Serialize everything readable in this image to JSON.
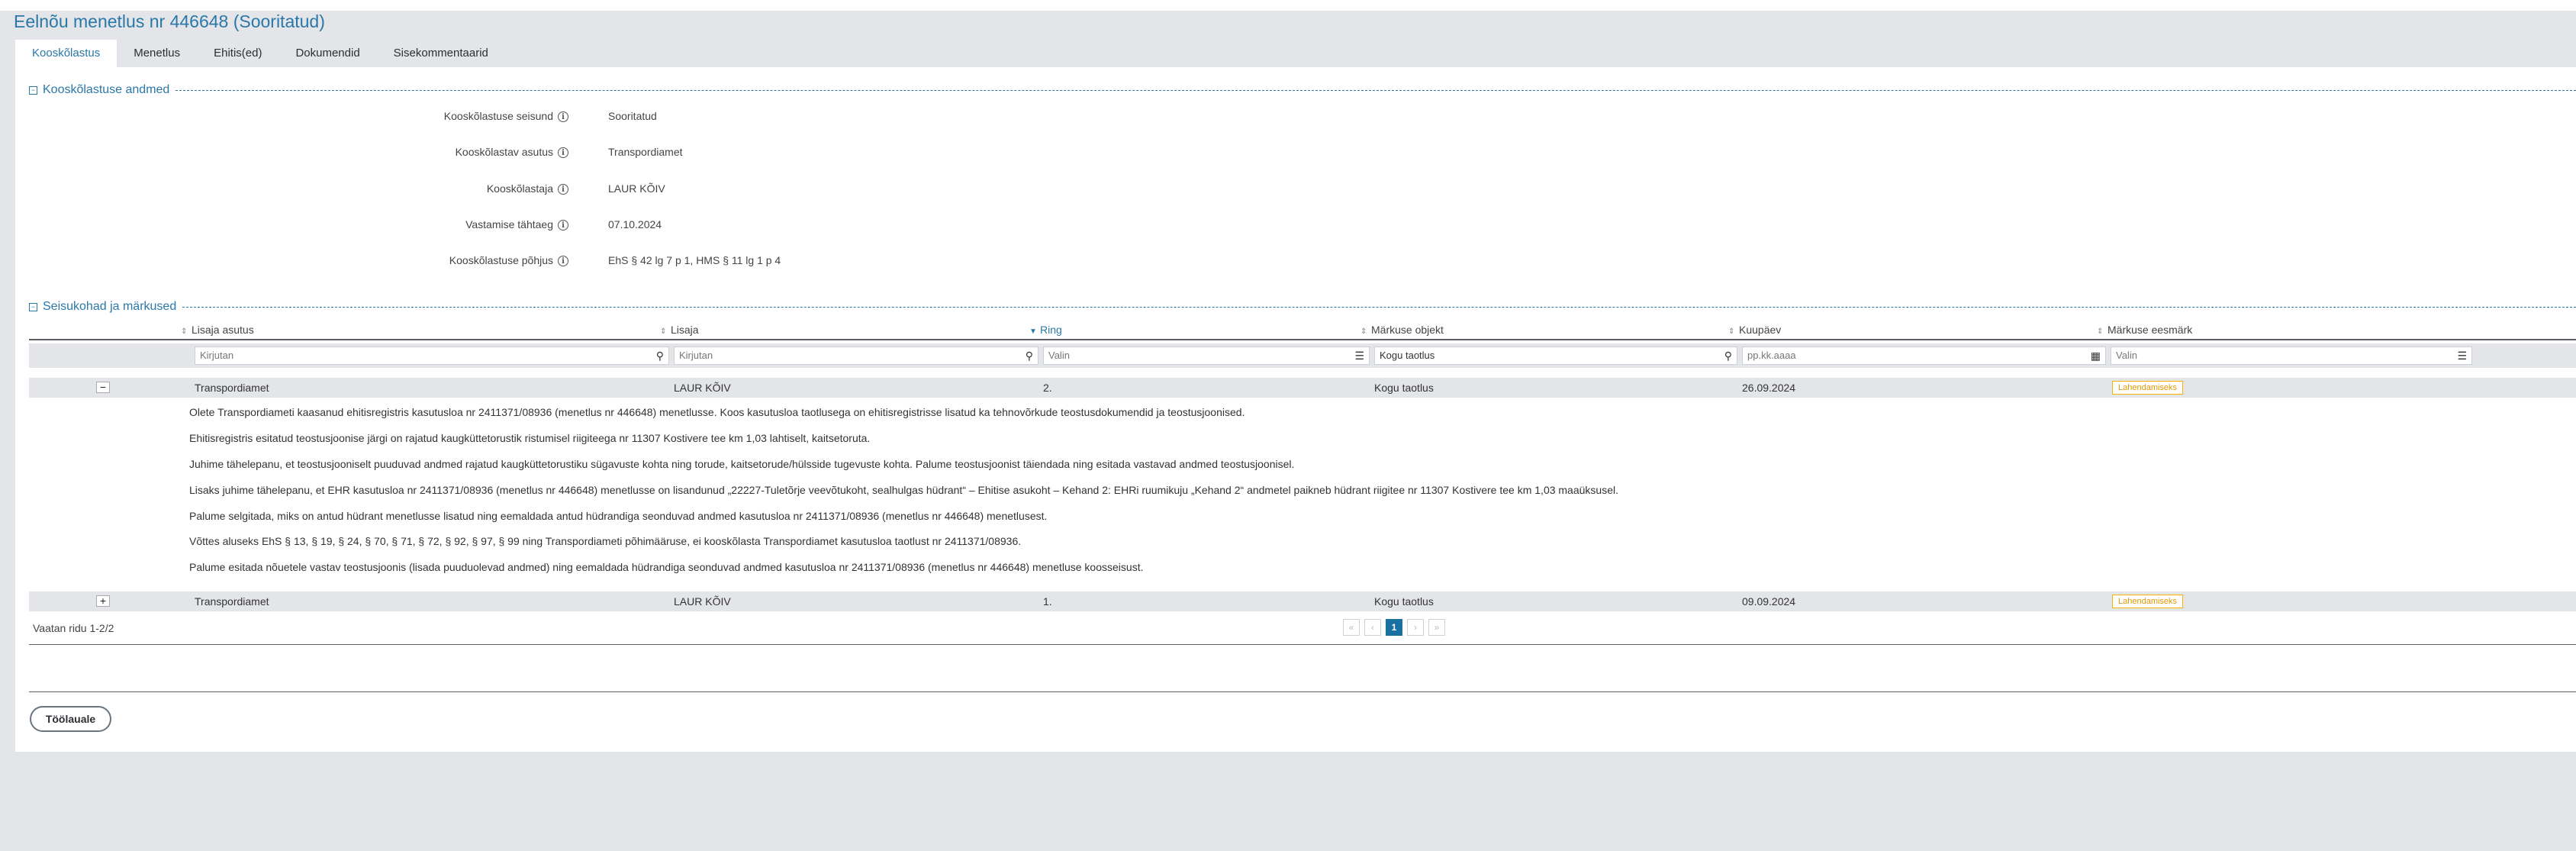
{
  "page_title": "Eelnõu menetlus nr 446648 (Sooritatud)",
  "tabs": [
    {
      "label": "Kooskõlastus",
      "active": true
    },
    {
      "label": "Menetlus"
    },
    {
      "label": "Ehitis(ed)"
    },
    {
      "label": "Dokumendid"
    },
    {
      "label": "Sisekommentaarid"
    }
  ],
  "section1": {
    "title": "Kooskõlastuse andmed",
    "fields": [
      {
        "label": "Kooskõlastuse seisund",
        "value": "Sooritatud"
      },
      {
        "label": "Kooskõlastav asutus",
        "value": "Transpordiamet"
      },
      {
        "label": "Kooskõlastaja",
        "value": "LAUR KÕIV"
      },
      {
        "label": "Vastamise tähtaeg",
        "value": "07.10.2024"
      },
      {
        "label": "Kooskõlastuse põhjus",
        "value": "EhS § 42 lg 7 p 1, HMS § 11 lg 1 p 4"
      }
    ]
  },
  "section2": {
    "title": "Seisukohad ja märkused",
    "columns": [
      "Lisaja asutus",
      "Lisaja",
      "Ring",
      "Märkuse objekt",
      "Kuupäev",
      "Märkuse eesmärk"
    ],
    "filters": [
      "Kirjutan",
      "Kirjutan",
      "Valin",
      "Kogu taotlus",
      "pp.kk.aaaa",
      "Valin"
    ],
    "rows": [
      {
        "expander": "−",
        "asutus": "Transpordiamet",
        "lisaja": "LAUR KÕIV",
        "ring": "2.",
        "objekt": "Kogu taotlus",
        "kuupaev": "26.09.2024",
        "eesmark": "Lahendamiseks",
        "details": [
          "Olete Transpordiameti kaasanud ehitisregistris kasutusloa nr 2411371/08936 (menetlus nr 446648) menetlusse. Koos kasutusloa taotlusega on ehitisregistrisse lisatud ka tehnovõrkude teostusdokumendid ja teostusjoonised.",
          "Ehitisregistris esitatud teostusjoonise järgi on rajatud kaugküttetorustik ristumisel riigiteega nr 11307 Kostivere tee km 1,03 lahtiselt, kaitsetoruta.",
          "Juhime tähelepanu, et teostusjooniselt puuduvad andmed rajatud kaugküttetorustiku sügavuste kohta ning torude, kaitsetorude/hülsside tugevuste kohta. Palume teostusjoonist täiendada ning esitada vastavad andmed teostusjoonisel.",
          "Lisaks juhime tähelepanu, et EHR kasutusloa nr 2411371/08936 (menetlus nr 446648) menetlusse on lisandunud „22227-Tuletõrje veevõtukoht, sealhulgas hüdrant“ – Ehitise asukoht – Kehand 2: EHRi ruumikuju „Kehand 2“ andmetel paikneb hüdrant riigitee nr 11307 Kostivere tee km 1,03 maaüksusel.",
          "Palume selgitada, miks on antud hüdrant menetlusse lisatud ning eemaldada antud hüdrandiga seonduvad andmed kasutusloa nr 2411371/08936 (menetlus nr 446648) menetlusest.",
          "Võttes aluseks EhS § 13, § 19, § 24, § 70, § 71, § 72, § 92, § 97, § 99 ning Transpordiameti põhimääruse, ei kooskõlasta Transpordiamet kasutusloa taotlust nr 2411371/08936.",
          "Palume esitada nõuetele vastav teostusjoonis (lisada puuduolevad andmed) ning eemaldada hüdrandiga seonduvad andmed kasutusloa nr 2411371/08936 (menetlus nr 446648) menetluse koosseisust."
        ]
      },
      {
        "expander": "+",
        "asutus": "Transpordiamet",
        "lisaja": "LAUR KÕIV",
        "ring": "1.",
        "objekt": "Kogu taotlus",
        "kuupaev": "09.09.2024",
        "eesmark": "Lahendamiseks"
      }
    ],
    "footer_info": "Vaatan ridu 1-2/2",
    "pager": {
      "first": "«",
      "prev": "‹",
      "current": "1",
      "next": "›",
      "last": "»"
    }
  },
  "back_button": "Töölauale",
  "colors": {
    "accent": "#2a78a8",
    "badge": "#f5b400"
  }
}
